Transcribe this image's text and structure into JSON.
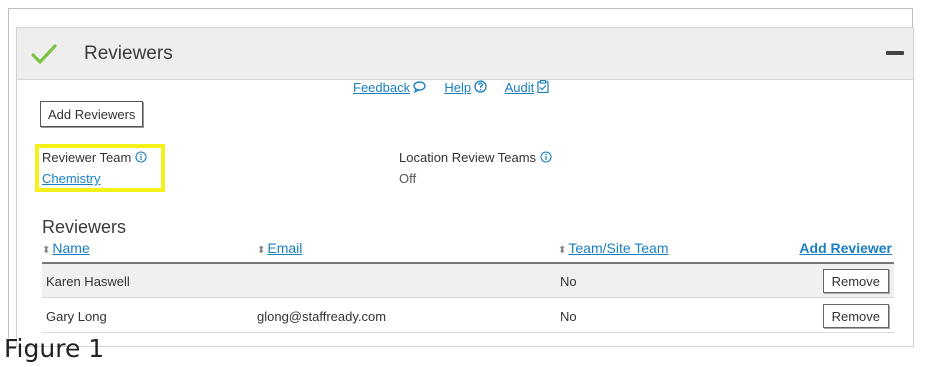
{
  "panel": {
    "title": "Reviewers",
    "colors": {
      "check": "#7dc142",
      "link": "#1a7fc0",
      "highlight": "#f3f01a"
    }
  },
  "links": {
    "feedback": "Feedback",
    "help": "Help",
    "audit": "Audit"
  },
  "actions": {
    "add_reviewers": "Add Reviewers"
  },
  "reviewer_team": {
    "label": "Reviewer Team",
    "value": "Chemistry"
  },
  "location_review_teams": {
    "label": "Location Review Teams",
    "value": "Off"
  },
  "reviewers": {
    "title": "Reviewers",
    "columns": {
      "name": "Name",
      "email": "Email",
      "team_site": "Team/Site Team"
    },
    "add_reviewer": "Add Reviewer",
    "rows": [
      {
        "name": "Karen Haswell",
        "email": "",
        "team_site": "No",
        "action": "Remove"
      },
      {
        "name": "Gary Long",
        "email": "glong@staffready.com",
        "team_site": "No",
        "action": "Remove"
      }
    ]
  },
  "caption": "Figure 1"
}
